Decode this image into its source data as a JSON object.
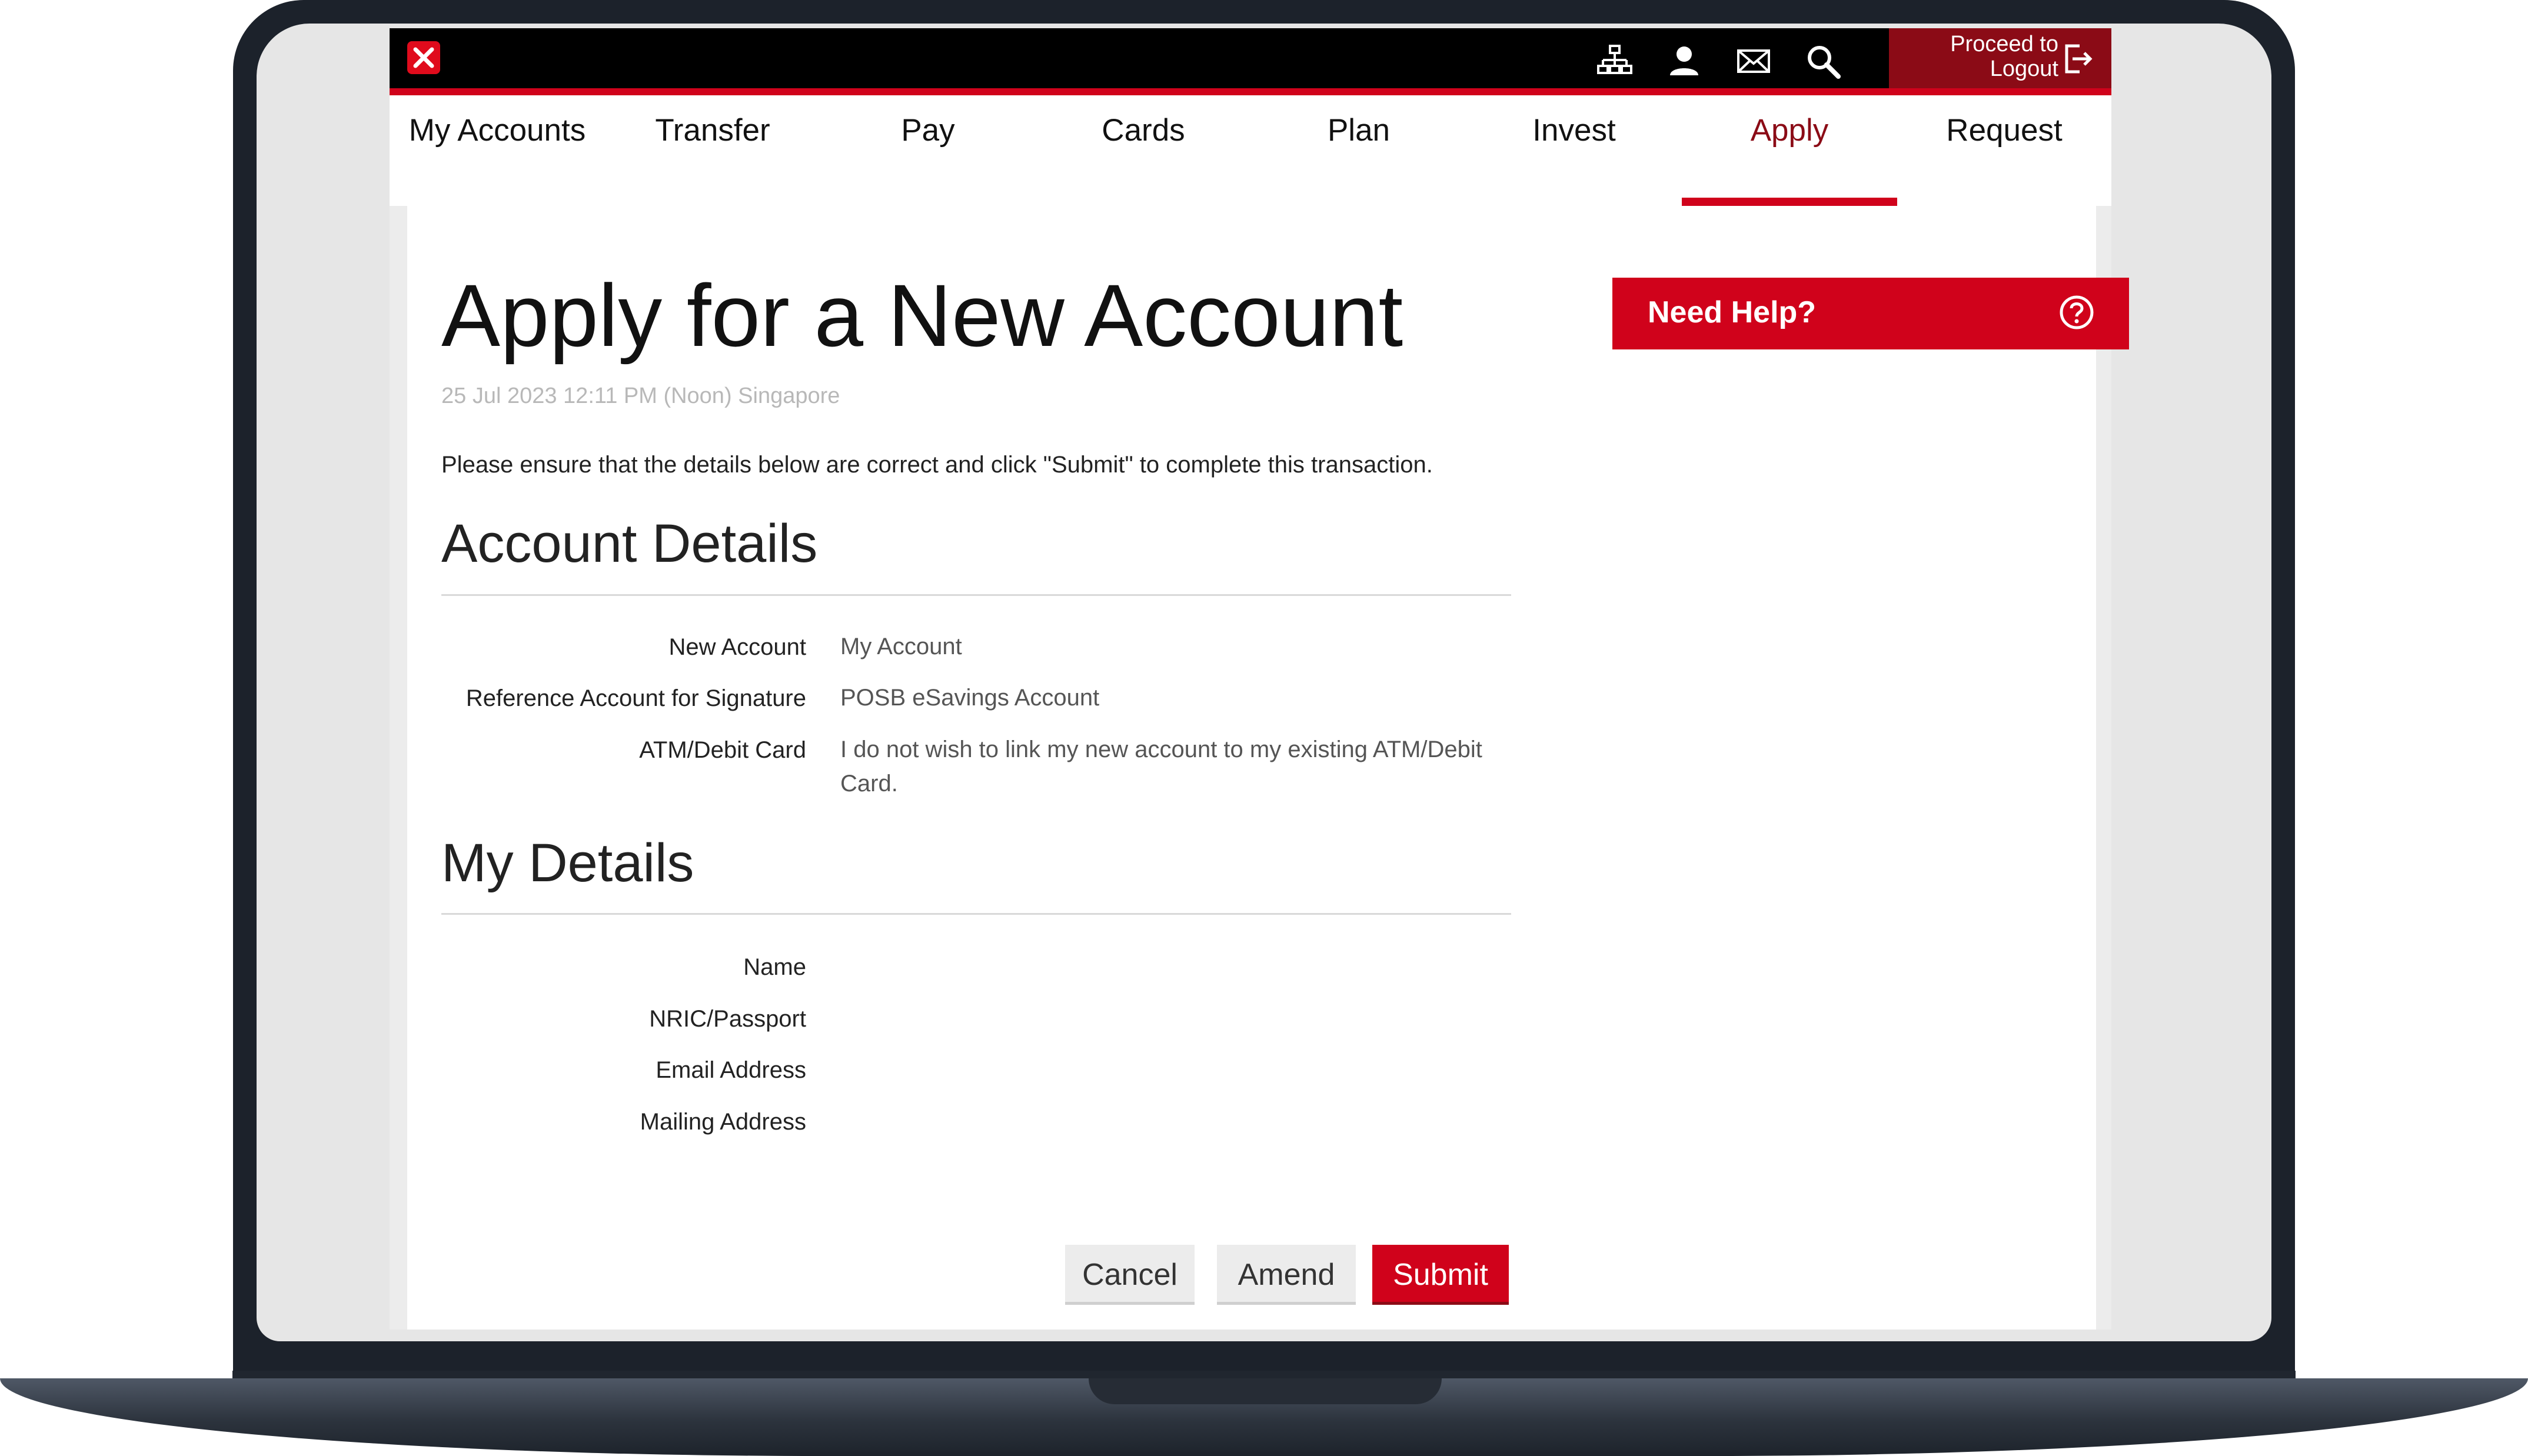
{
  "header": {
    "logout_line1": "Proceed to",
    "logout_line2": "Logout",
    "icons": [
      "sitemap-icon",
      "user-icon",
      "mail-icon",
      "search-icon",
      "logout-icon"
    ]
  },
  "nav": {
    "tabs": [
      {
        "label": "My Accounts"
      },
      {
        "label": "Transfer"
      },
      {
        "label": "Pay"
      },
      {
        "label": "Cards"
      },
      {
        "label": "Plan"
      },
      {
        "label": "Invest"
      },
      {
        "label": "Apply"
      },
      {
        "label": "Request"
      }
    ],
    "active": "Apply"
  },
  "page": {
    "title": "Apply for a New Account",
    "timestamp": "25 Jul 2023 12:11 PM (Noon) Singapore",
    "instruction": "Please ensure that the details below are correct and click \"Submit\" to complete this transaction."
  },
  "account_details": {
    "heading": "Account Details",
    "rows": [
      {
        "label": "New Account",
        "value": "My Account"
      },
      {
        "label": "Reference Account for Signature",
        "value": "POSB eSavings Account"
      },
      {
        "label": "ATM/Debit Card",
        "value": "I do not wish to link my new account to my existing ATM/Debit Card."
      }
    ]
  },
  "my_details": {
    "heading": "My Details",
    "rows": [
      {
        "label": "Name",
        "value": ""
      },
      {
        "label": "NRIC/Passport",
        "value": ""
      },
      {
        "label": "Email Address",
        "value": ""
      },
      {
        "label": "Mailing Address",
        "value": ""
      }
    ]
  },
  "actions": {
    "cancel": "Cancel",
    "amend": "Amend",
    "submit": "Submit"
  },
  "help": {
    "label": "Need Help?"
  },
  "colors": {
    "brand_red": "#d0021b",
    "dark_red": "#8b0b16",
    "topbar": "#000000"
  }
}
